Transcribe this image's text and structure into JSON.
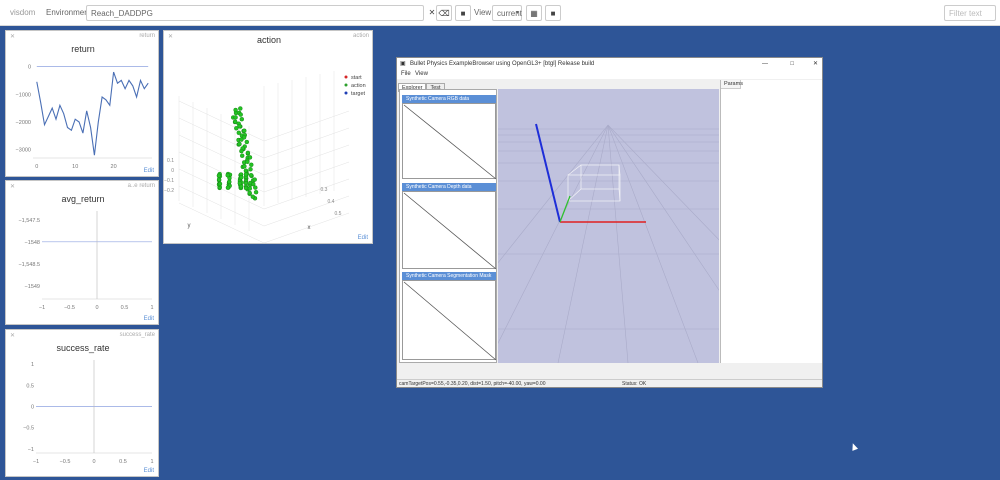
{
  "topbar": {
    "brand": "visdom",
    "env_label": "Environment",
    "env_value": "Reach_DADDPG",
    "view_label": "View",
    "view_value": "current",
    "filter_placeholder": "Filter text",
    "icons": [
      "close-icon",
      "chevron-down-icon",
      "eraser-icon",
      "folder-icon",
      "grid-icon",
      "folder-icon"
    ]
  },
  "panes": {
    "return": {
      "title": "return",
      "corner": "return",
      "edit": "Edit",
      "chart_data": {
        "type": "line",
        "title": "return",
        "x": [
          0,
          1,
          2,
          3,
          4,
          5,
          6,
          7,
          8,
          9,
          10,
          11,
          12,
          13,
          14,
          15,
          16,
          17,
          18,
          19,
          20,
          21,
          22,
          23,
          24,
          25,
          26,
          27,
          28,
          29
        ],
        "series": [
          {
            "values": [
              -550,
              -1300,
              -2100,
              -1800,
              -1500,
              -1900,
              -1400,
              -1700,
              -2200,
              -2300,
              -1900,
              -2000,
              -2400,
              -1600,
              -2200,
              -3200,
              -2000,
              -1100,
              -1200,
              -1400,
              -200,
              -600,
              -500,
              -800,
              -500,
              -700,
              -1100,
              -500,
              -800,
              -600
            ],
            "color": "#4a6fb5"
          },
          {
            "values": [
              0,
              0,
              0,
              0,
              0,
              0,
              0,
              0,
              0,
              0,
              0,
              0,
              0,
              0,
              0,
              0,
              0,
              0,
              0,
              0,
              0,
              0,
              0,
              0,
              0,
              0,
              0,
              0,
              0,
              0
            ],
            "color": "#8fa3e0"
          }
        ],
        "xticks": [
          0,
          10,
          20
        ],
        "yticks": [
          0,
          -1000,
          -2000,
          -3000
        ],
        "ytick_labels": [
          "0",
          "−1000",
          "−2000",
          "−3000"
        ],
        "xlim": [
          -1,
          30
        ],
        "ylim": [
          -3300,
          200
        ],
        "grid": false
      }
    },
    "avg_return": {
      "title": "avg_return",
      "corner": "a..e return",
      "edit": "Edit",
      "chart_data": {
        "type": "line",
        "title": "avg_return",
        "x": [
          0
        ],
        "series": [
          {
            "values": [
              -1548
            ],
            "color": "#8fa3e0"
          }
        ],
        "xticks": [
          -1,
          -0.5,
          0,
          0.5,
          1
        ],
        "xtick_labels": [
          "−1",
          "−0.5",
          "0",
          "0.5",
          "1"
        ],
        "yticks": [
          -1547.5,
          -1548,
          -1548.5,
          -1549
        ],
        "ytick_labels": [
          "−1,547.5",
          "−1548",
          "−1,548.5",
          "−1549"
        ],
        "xlim": [
          -1,
          1
        ],
        "ylim": [
          -1549.3,
          -1547.3
        ],
        "grid": false
      }
    },
    "success_rate": {
      "title": "success_rate",
      "corner": "success_rate",
      "edit": "Edit",
      "chart_data": {
        "type": "line",
        "title": "success_rate",
        "x": [
          0
        ],
        "series": [
          {
            "values": [
              0
            ],
            "color": "#8fa3e0"
          }
        ],
        "xticks": [
          -1,
          -0.5,
          0,
          0.5,
          1
        ],
        "xtick_labels": [
          "−1",
          "−0.5",
          "0",
          "0.5",
          "1"
        ],
        "yticks": [
          1,
          0.5,
          0,
          -0.5,
          -1
        ],
        "ytick_labels": [
          "1",
          "0.5",
          "0",
          "−0.5",
          "−1"
        ],
        "xlim": [
          -1,
          1
        ],
        "ylim": [
          -1.1,
          1.1
        ],
        "grid": false
      }
    },
    "action": {
      "title": "action",
      "corner": "action",
      "edit": "Edit",
      "chart_data": {
        "type": "scatter",
        "title": "action",
        "legend": [
          "start",
          "action",
          "target"
        ],
        "legend_colors": [
          "#d62728",
          "#2ca02c",
          "#1f3fb5"
        ],
        "legend_position": "top-right",
        "axis_labels": {
          "x": "x",
          "y": "y"
        },
        "x_tick_labels": [
          "0.3",
          "0.4",
          "0.5"
        ],
        "y_tick_labels": [
          "0.1",
          "0",
          "−0.1",
          "−0.2"
        ],
        "grid": true
      }
    }
  },
  "bullet": {
    "title": "Bullet Physics ExampleBrowser using OpenGL3+ [btgl] Release build",
    "menu": [
      "File",
      "View"
    ],
    "tabs": [
      "Explorer",
      "Test"
    ],
    "cameras": [
      "Synthetic Camera RGB data",
      "Synthetic Camera Depth data",
      "Synthetic Camera Segmentation Mask"
    ],
    "params_label": "Params",
    "status_left": "camTargetPos=0.55,-0.35,0.20, dist=1.50, pitch=-40.00, yaw=0.00",
    "status_right": "Status: OK",
    "window_controls": [
      "—",
      "□",
      "✕"
    ]
  }
}
